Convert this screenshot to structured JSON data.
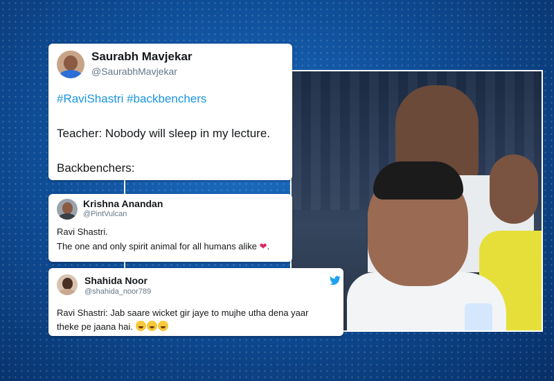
{
  "tweets": [
    {
      "name": "Saurabh Mavjekar",
      "handle": "@SaurabhMavjekar",
      "hashtags": "#RaviShastri #backbenchers",
      "line1": "Teacher: Nobody will sleep in my lecture.",
      "line2": "Backbenchers:",
      "avatar_icon": "user-avatar-icon"
    },
    {
      "name": "Krishna Anandan",
      "handle": "@PintVulcan",
      "line1": "Ravi Shastri.",
      "line2": "The one and only spirit animal for all humans alike",
      "line2_suffix": ".",
      "emoji": "❤",
      "avatar_icon": "user-avatar-icon"
    },
    {
      "name": "Shahida Noor",
      "handle": "@shahida_noor789",
      "line1": "Ravi Shastri: Jab saare wicket gir jaye to mujhe utha dena yaar",
      "line2": "theke pe jaana hai.",
      "emoji": "😂😂😂",
      "avatar_icon": "user-avatar-icon",
      "brand_icon": "twitter-bird-icon"
    }
  ],
  "photo": {
    "description_icon": "photo-image"
  },
  "colors": {
    "background": "#0f4f9a",
    "hashtag": "#1b95e0",
    "handle": "#657786",
    "twitter_blue": "#1da1f2",
    "heart": "#e0245e"
  }
}
